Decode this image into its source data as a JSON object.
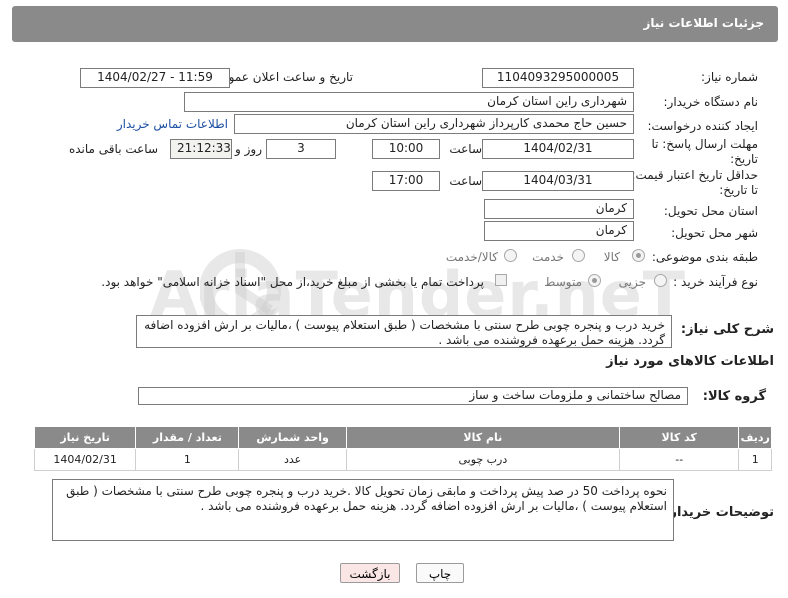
{
  "header": {
    "title": "جزئیات اطلاعات نیاز"
  },
  "form": {
    "need_number_label": "شماره نیاز:",
    "need_number": "1104093295000005",
    "announce_label": "تاریخ و ساعت اعلان عمومی:",
    "announce_value": "1404/02/27 - 11:59",
    "buyer_org_label": "نام دستگاه خریدار:",
    "buyer_org": "شهرداری راین استان کرمان",
    "creator_label": "ایجاد کننده درخواست:",
    "creator": "حسین حاج محمدی کارپرداز شهرداری راین استان کرمان",
    "contact_link": "اطلاعات تماس خریدار",
    "deadline_label": "مهلت ارسال پاسخ: تا تاریخ:",
    "deadline_date": "1404/02/31",
    "time_label": "ساعت",
    "deadline_time": "10:00",
    "days_value": "3",
    "days_label": "روز و",
    "remaining_time": "21:12:33",
    "remaining_label": "ساعت باقی مانده",
    "validity_label": "حداقل تاریخ اعتبار قیمت: تا تاریخ:",
    "validity_date": "1404/03/31",
    "validity_time": "17:00",
    "province_label": "استان محل تحویل:",
    "province": "کرمان",
    "city_label": "شهر محل تحویل:",
    "city": "کرمان",
    "category_label": "طبقه بندی موضوعی:",
    "category_options": [
      "کالا",
      "خدمت",
      "کالا/خدمت"
    ],
    "process_label": "نوع فرآیند خرید :",
    "process_options": [
      "جزیی",
      "متوسط"
    ],
    "payment_note": "پرداخت تمام یا بخشی از مبلغ خرید،از محل \"اسناد خزانه اسلامی\" خواهد بود."
  },
  "description": {
    "label": "شرح کلی نیاز:",
    "text": "خرید درب و پنجره چوبی طرح سنتی با مشخصات ( طبق استعلام پیوست ) ،مالیات بر ارش افزوده اضافه گردد. هزینه حمل برعهده فروشنده می باشد ."
  },
  "goods": {
    "section_title": "اطلاعات کالاهای مورد نیاز",
    "group_label": "گروه کالا:",
    "group_value": "مصالح ساختمانی و ملزومات ساخت و ساز",
    "columns": [
      "ردیف",
      "کد کالا",
      "نام کالا",
      "واحد شمارش",
      "تعداد / مقدار",
      "تاریخ نیاز"
    ],
    "rows": [
      [
        "1",
        "--",
        "درب چوبی",
        "عدد",
        "1",
        "1404/02/31"
      ]
    ]
  },
  "buyer_notes": {
    "label": "توضیحات خریدار:",
    "text": "نحوه پرداخت 50 در صد پیش پرداخت و مابقی زمان تحویل کالا .خرید درب و پنجره چوبی طرح سنتی با مشخصات ( طبق استعلام پیوست ) ،مالیات بر ارش افزوده اضافه گردد. هزینه حمل برعهده فروشنده می باشد ."
  },
  "buttons": {
    "print": "چاپ",
    "back": "بازگشت"
  },
  "watermark": {
    "brand": "AriaTender.neT"
  },
  "colors": {
    "header_bg": "#8a8a8a",
    "link": "#1d4fa3",
    "back_btn": "#fbe6e6"
  }
}
